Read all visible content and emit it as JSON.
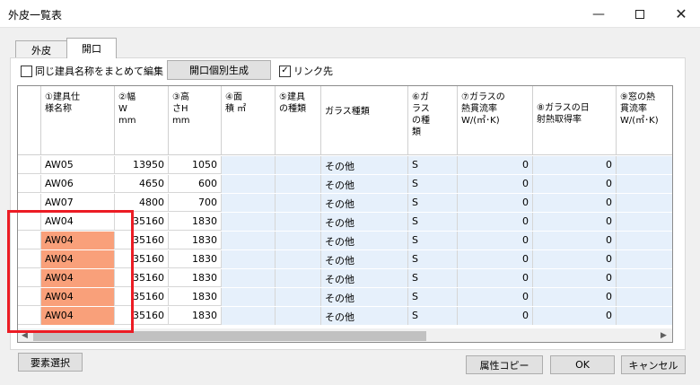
{
  "window": {
    "title": "外皮一覧表"
  },
  "tabs": [
    {
      "label": "外皮"
    },
    {
      "label": "開口"
    }
  ],
  "toolbar": {
    "same_name_label": "同じ建具名称をまとめて編集",
    "same_name_checked": false,
    "generate_button": "開口個別生成",
    "link_label": "リンク先",
    "link_checked": true,
    "link_check_mark": "✓"
  },
  "table": {
    "headers": [
      "①建具仕\n様名称",
      "②幅\nW\nmm",
      "③高\nさH\nmm",
      "④面\n積 ㎡",
      "⑤建具\nの種類",
      "ガラス種類",
      "⑥ガ\nラス\nの種\n類",
      "⑦ガラスの\n熱貫流率\nW/(㎡･K)",
      "⑧ガラスの日\n射熱取得率",
      "⑨窓の熱\n貫流率\nW/(㎡･K)"
    ],
    "rows": [
      {
        "name": "AW05",
        "width": "13950",
        "height": "1050",
        "glass_type": "その他",
        "glass_kind": "S",
        "u_glass": "0",
        "shgc": "0",
        "highlight": false
      },
      {
        "name": "AW06",
        "width": "4650",
        "height": "600",
        "glass_type": "その他",
        "glass_kind": "S",
        "u_glass": "0",
        "shgc": "0",
        "highlight": false
      },
      {
        "name": "AW07",
        "width": "4800",
        "height": "700",
        "glass_type": "その他",
        "glass_kind": "S",
        "u_glass": "0",
        "shgc": "0",
        "highlight": false
      },
      {
        "name": "AW04",
        "width": "35160",
        "height": "1830",
        "glass_type": "その他",
        "glass_kind": "S",
        "u_glass": "0",
        "shgc": "0",
        "highlight": false
      },
      {
        "name": "AW04",
        "width": "35160",
        "height": "1830",
        "glass_type": "その他",
        "glass_kind": "S",
        "u_glass": "0",
        "shgc": "0",
        "highlight": true
      },
      {
        "name": "AW04",
        "width": "35160",
        "height": "1830",
        "glass_type": "その他",
        "glass_kind": "S",
        "u_glass": "0",
        "shgc": "0",
        "highlight": true
      },
      {
        "name": "AW04",
        "width": "35160",
        "height": "1830",
        "glass_type": "その他",
        "glass_kind": "S",
        "u_glass": "0",
        "shgc": "0",
        "highlight": true
      },
      {
        "name": "AW04",
        "width": "35160",
        "height": "1830",
        "glass_type": "その他",
        "glass_kind": "S",
        "u_glass": "0",
        "shgc": "0",
        "highlight": true
      },
      {
        "name": "AW04",
        "width": "35160",
        "height": "1830",
        "glass_type": "その他",
        "glass_kind": "S",
        "u_glass": "0",
        "shgc": "0",
        "highlight": true
      }
    ]
  },
  "footer": {
    "select_button": "要素選択",
    "copy_button": "属性コピー",
    "ok_button": "OK",
    "cancel_button": "キャンセル"
  },
  "colors": {
    "highlight_cell": "#f9a07a",
    "editable_cell": "#e6f0fb",
    "annotation_box": "#ec1c24"
  },
  "icons": {
    "minimize": "—",
    "close": "✕",
    "scroll_up": "▲",
    "scroll_down": "▼",
    "scroll_left": "◀",
    "scroll_right": "▶"
  }
}
